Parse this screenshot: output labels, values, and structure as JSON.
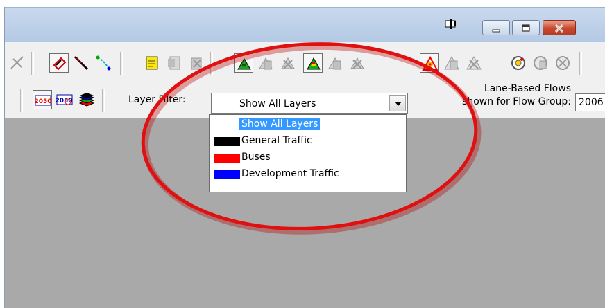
{
  "toolbar2": {
    "layer_filter_label": "Layer Filter:",
    "layer_filter_value": "Show All Layers",
    "flows_label_line1": "Lane-Based Flows",
    "flows_label_line2": "shown for Flow Group:",
    "flow_group_value": "2006"
  },
  "dropdown": {
    "items": [
      {
        "label": "Show All Layers",
        "color": null,
        "selected": true
      },
      {
        "label": "General Traffic",
        "color": "#000000"
      },
      {
        "label": "Buses",
        "color": "#ff0000"
      },
      {
        "label": "Development Traffic",
        "color": "#0000ff"
      }
    ]
  },
  "icons": {
    "year_2050": "2050",
    "year_2050b": "2050"
  },
  "colors": {
    "annotation": "#e01010",
    "selection": "#3399ff",
    "canvas": "#a9a9a9"
  }
}
